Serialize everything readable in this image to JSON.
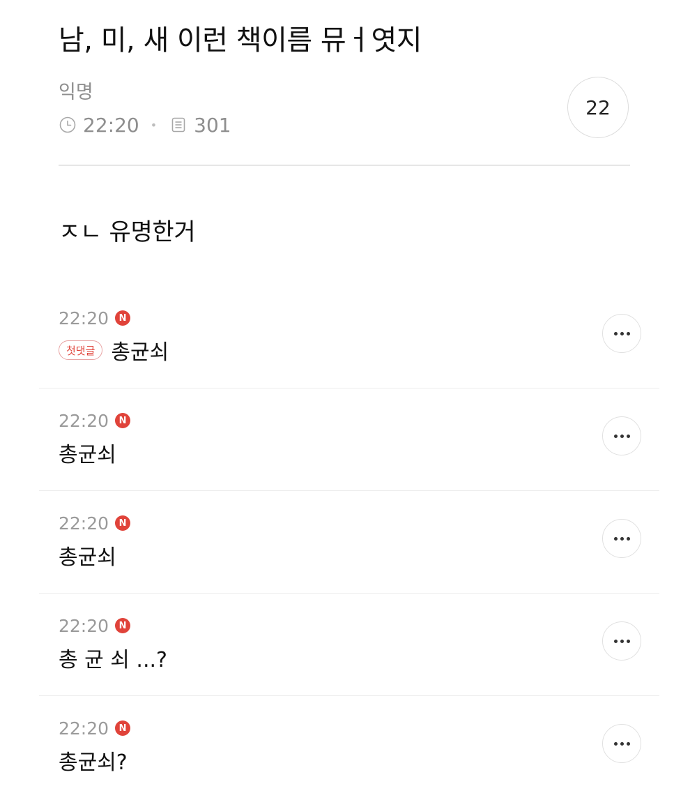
{
  "post": {
    "title": "남, 미, 새 이런 책이름 뮤ㅓ엿지",
    "author": "익명",
    "time": "22:20",
    "views": "301",
    "comment_count": "22",
    "body": "ㅈㄴ 유명한거",
    "icons": {
      "time": "clock-icon",
      "views": "document-icon"
    }
  },
  "comments": [
    {
      "time": "22:20",
      "new_badge": "N",
      "first_tag": "첫댓글",
      "text": "총균쇠"
    },
    {
      "time": "22:20",
      "new_badge": "N",
      "text": "총균쇠"
    },
    {
      "time": "22:20",
      "new_badge": "N",
      "text": "총균쇠"
    },
    {
      "time": "22:20",
      "new_badge": "N",
      "text": "총 균 쇠 ...?"
    },
    {
      "time": "22:20",
      "new_badge": "N",
      "text": "총균쇠?"
    }
  ],
  "colors": {
    "accent_red": "#e0433a",
    "muted_text": "#8e8e8e",
    "divider": "#e6e6e6"
  }
}
